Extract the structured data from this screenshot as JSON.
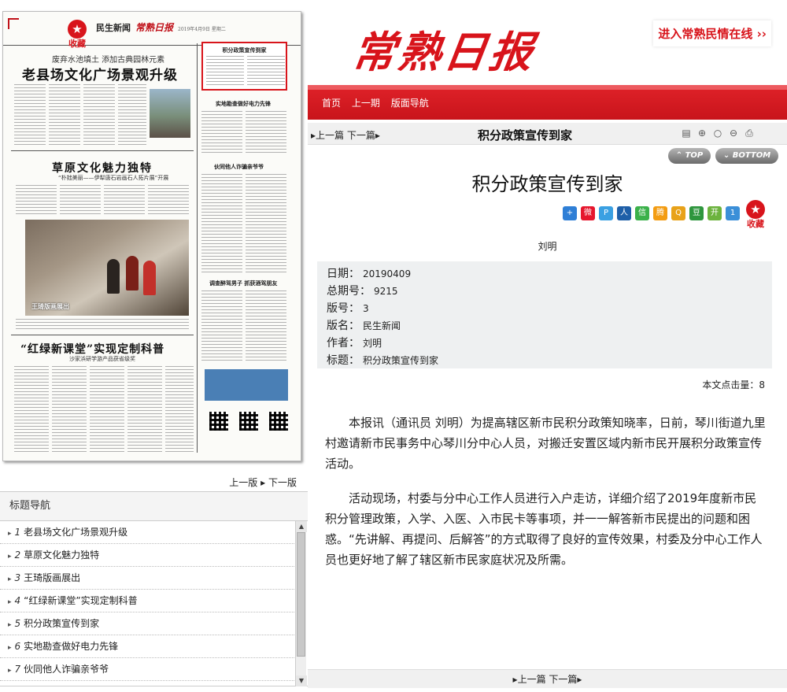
{
  "newspaper_thumb": {
    "favorite_label": "收藏",
    "section": "民生新闻",
    "brand": "常熟日报",
    "date_line": "2019年4月9日 星期二",
    "subtitle": "废弃水池填土 添加古典园林元素",
    "headline1": "老县场文化广场景观升级",
    "box_title": "积分政策宣传到家",
    "headline2": "草原文化魅力独特",
    "headline2_sub": "“朴拙美丽——伊犁唐石岩画石人拓片展”开展",
    "mini1": "实地勘查做好电力先锋",
    "mini2": "伙同他人诈骗亲爷爷",
    "mini3": "调查醉驾男子 抓获酒驾朋友",
    "photo_caption": "王琦版画展出",
    "headline3": "“红绿新课堂”实现定制科普",
    "headline3_sub": "沙家浜研学游产品获省级奖"
  },
  "left_pager": {
    "prev": "上一版",
    "next": "下一版"
  },
  "toc": {
    "title": "标题导航",
    "items": [
      {
        "num": "1",
        "label": "老县场文化广场景观升级"
      },
      {
        "num": "2",
        "label": "草原文化魅力独特"
      },
      {
        "num": "3",
        "label": "王琦版画展出"
      },
      {
        "num": "4",
        "label": "“红绿新课堂”实现定制科普"
      },
      {
        "num": "5",
        "label": "积分政策宣传到家"
      },
      {
        "num": "6",
        "label": "实地勘查做好电力先锋"
      },
      {
        "num": "7",
        "label": "伙同他人诈骗亲爷爷"
      }
    ]
  },
  "header": {
    "logo": "常熟日报",
    "enter_link": "进入常熟民情在线 ››",
    "nav": [
      "首页",
      "上一期",
      "版面导航"
    ]
  },
  "article_bar": {
    "prev": "上一篇",
    "next": "下一篇",
    "title": "积分政策宣传到家",
    "top_label": "TOP",
    "bottom_label": "BOTTOM"
  },
  "article": {
    "title": "积分政策宣传到家",
    "favorite_label": "收藏",
    "author": "刘明",
    "meta": [
      {
        "label": "日期：",
        "value": "20190409"
      },
      {
        "label": "总期号：",
        "value": "9215"
      },
      {
        "label": "版号：",
        "value": "3"
      },
      {
        "label": "版名：",
        "value": "民生新闻"
      },
      {
        "label": "作者：",
        "value": "刘明"
      },
      {
        "label": "标题：",
        "value": "积分政策宣传到家"
      }
    ],
    "hits_label": "本文点击量：",
    "hits_value": "8",
    "paragraphs": [
      "本报讯（通讯员 刘明）为提高辖区新市民积分政策知晓率，日前，琴川街道九里村邀请新市民事务中心琴川分中心人员，对搬迁安置区域内新市民开展积分政策宣传活动。",
      "活动现场，村委与分中心工作人员进行入户走访，详细介绍了2019年度新市民积分管理政策，入学、入医、入市民卡等事项，并一一解答新市民提出的问题和困惑。“先讲解、再提问、后解答”的方式取得了良好的宣传效果，村委及分中心工作人员也更好地了解了辖区新市民家庭状况及所需。"
    ]
  },
  "share_icons": [
    {
      "name": "add-share-icon",
      "glyph": "+",
      "color": "#2f7fd6"
    },
    {
      "name": "weibo-share-icon",
      "glyph": "微",
      "color": "#e6162d"
    },
    {
      "name": "qzone-share-icon",
      "glyph": "P",
      "color": "#3aa0e2"
    },
    {
      "name": "renren-share-icon",
      "glyph": "人",
      "color": "#1e5fa8"
    },
    {
      "name": "wechat-share-icon",
      "glyph": "信",
      "color": "#3bb14a"
    },
    {
      "name": "tqq-share-icon",
      "glyph": "腾",
      "color": "#f39c12"
    },
    {
      "name": "qq-share-icon",
      "glyph": "Q",
      "color": "#e8a21a"
    },
    {
      "name": "douban-share-icon",
      "glyph": "豆",
      "color": "#2e963d"
    },
    {
      "name": "kaixin-share-icon",
      "glyph": "开",
      "color": "#6cb33e"
    },
    {
      "name": "more-share-icon",
      "glyph": "1",
      "color": "#3b8fd8"
    }
  ],
  "bottom_pager": {
    "prev": "上一篇",
    "next": "下一篇"
  }
}
